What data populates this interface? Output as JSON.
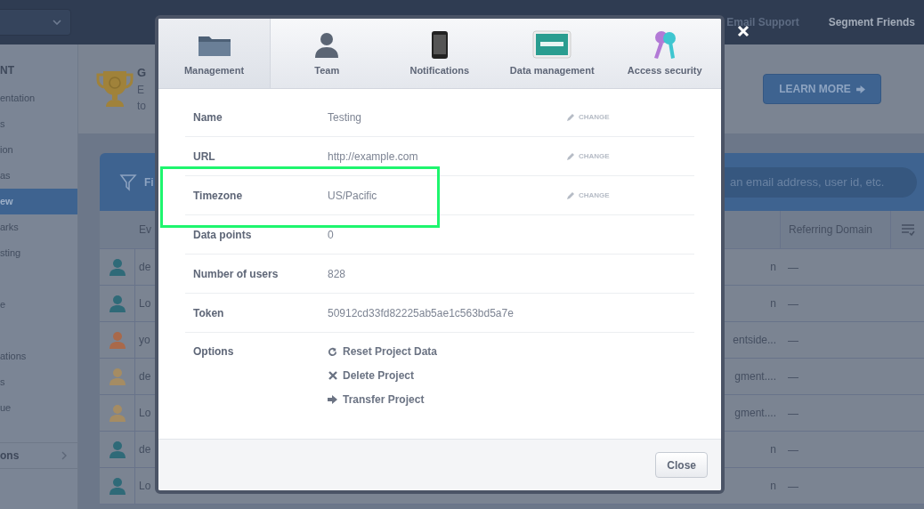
{
  "top_bar": {
    "links": [
      "Email Support",
      "Segment Friends"
    ]
  },
  "sidebar": {
    "heading": "NT",
    "items": [
      {
        "label": "entation",
        "selected": false
      },
      {
        "label": "s",
        "selected": false
      },
      {
        "label": "ion",
        "selected": false
      },
      {
        "label": "as",
        "selected": false
      },
      {
        "label": "ew",
        "selected": true
      },
      {
        "label": "arks",
        "selected": false
      },
      {
        "label": "sting",
        "selected": false
      },
      {
        "label": "e",
        "selected": false
      },
      {
        "label": "ations",
        "selected": false
      },
      {
        "label": "s",
        "selected": false
      },
      {
        "label": "ue",
        "selected": false
      }
    ],
    "footer_item": "ons"
  },
  "promo": {
    "title": "G",
    "lines": [
      "E",
      "to"
    ],
    "button": "LEARN MORE"
  },
  "filter_bar": {
    "label": "Fi",
    "search": {
      "placeholder": "an email address, user id, etc."
    }
  },
  "table": {
    "header": {
      "column_2": "Ev",
      "referring_domain": "Referring Domain"
    },
    "rows": [
      {
        "color": "#2f6a78",
        "column_2": "de",
        "column_3": "n",
        "referring_domain": "—"
      },
      {
        "color": "#2f6a78",
        "column_2": "Lo",
        "column_3": "n",
        "referring_domain": "—"
      },
      {
        "color": "#a9694a",
        "column_2": "yo",
        "column_3": "entside...",
        "referring_domain": "—"
      },
      {
        "color": "#a58c63",
        "column_2": "de",
        "column_3": "gment....",
        "referring_domain": "—"
      },
      {
        "color": "#a58c63",
        "column_2": "Lo",
        "column_3": "gment....",
        "referring_domain": "—"
      },
      {
        "color": "#2f6a78",
        "column_2": "de",
        "column_3": "n",
        "referring_domain": "—"
      },
      {
        "color": "#2f6a78",
        "column_2": "Lo",
        "column_3": "n",
        "referring_domain": "—"
      }
    ]
  },
  "modal": {
    "tabs": [
      {
        "kind": "folder",
        "label": "Management",
        "selected": true
      },
      {
        "kind": "person",
        "label": "Team",
        "selected": false
      },
      {
        "kind": "phone",
        "label": "Notifications",
        "selected": false
      },
      {
        "kind": "screen",
        "label": "Data management",
        "selected": false
      },
      {
        "kind": "keys",
        "label": "Access security",
        "selected": false
      }
    ],
    "rows": [
      {
        "label": "Name",
        "value": "Testing",
        "action": "CHANGE",
        "highlighted": false
      },
      {
        "label": "URL",
        "value": "http://example.com",
        "action": "CHANGE",
        "highlighted": false
      },
      {
        "label": "Timezone",
        "value": "US/Pacific",
        "action": "CHANGE",
        "highlighted": true
      },
      {
        "label": "Data points",
        "value": "0",
        "highlighted": false
      },
      {
        "label": "Number of users",
        "value": "828",
        "highlighted": false
      },
      {
        "label": "Token",
        "value": "50912cd33fd82225ab5ae1c563bd5a7e",
        "highlighted": false
      }
    ],
    "options": {
      "label": "Options",
      "items": [
        {
          "kind": "reset",
          "label": "Reset Project Data"
        },
        {
          "kind": "delete",
          "label": "Delete Project"
        },
        {
          "kind": "transfer",
          "label": "Transfer Project"
        }
      ]
    },
    "close_button": "Close"
  }
}
